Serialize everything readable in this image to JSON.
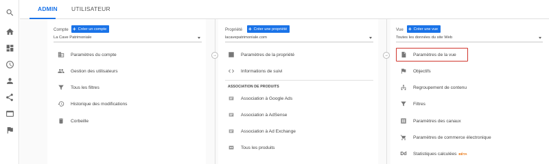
{
  "rail": {
    "icons": [
      "search-icon",
      "home-icon",
      "dashboard-icon",
      "clock-icon",
      "person-icon",
      "share-icon",
      "display-icon",
      "flag-icon"
    ]
  },
  "tabs": [
    {
      "label": "ADMIN",
      "active": true
    },
    {
      "label": "UTILISATEUR",
      "active": false
    }
  ],
  "columns": {
    "compte": {
      "label": "Compte",
      "create_label": "Créer un compte",
      "selected": "La Cave Patrimoniale",
      "items": [
        {
          "label": "Paramètres du compte",
          "icon": "building-icon"
        },
        {
          "label": "Gestion des utilisateurs",
          "icon": "users-icon"
        },
        {
          "label": "Tous les filtres",
          "icon": "filter-icon"
        },
        {
          "label": "Historique des modifications",
          "icon": "history-icon"
        },
        {
          "label": "Corbeille",
          "icon": "trash-icon"
        }
      ]
    },
    "propriete": {
      "label": "Propriété",
      "create_label": "Créer une propriété",
      "selected": "lacavepatrimoniale.com",
      "items": [
        {
          "label": "Paramètres de la propriété",
          "icon": "square-icon"
        },
        {
          "label": "Informations de suivi",
          "icon": "code-icon"
        }
      ],
      "section_head": "ASSOCIATION DE PRODUITS",
      "section_items": [
        {
          "label": "Association à Google Ads",
          "icon": "link-block-icon"
        },
        {
          "label": "Association à AdSense",
          "icon": "link-block-icon"
        },
        {
          "label": "Association à Ad Exchange",
          "icon": "link-block-icon"
        },
        {
          "label": "Tous les produits",
          "icon": "link-block-icon"
        }
      ]
    },
    "vue": {
      "label": "Vue",
      "create_label": "Créer une vue",
      "selected": "Toutes les données du site Web",
      "items": [
        {
          "label": "Paramètres de la vue",
          "icon": "document-icon"
        },
        {
          "label": "Objectifs",
          "icon": "flag-icon"
        },
        {
          "label": "Regroupement de contenu",
          "icon": "hierarchy-icon"
        },
        {
          "label": "Filtres",
          "icon": "filter-icon"
        },
        {
          "label": "Paramètres des canaux",
          "icon": "channels-icon"
        },
        {
          "label": "Paramètres de commerce électronique",
          "icon": "cart-icon"
        },
        {
          "label": "Statistiques calculées",
          "icon": "dd-icon",
          "badge": "BÊTA"
        }
      ]
    }
  },
  "colors": {
    "accent": "#1a73e8",
    "highlight": "#d0342c",
    "beta": "#e8710a"
  }
}
